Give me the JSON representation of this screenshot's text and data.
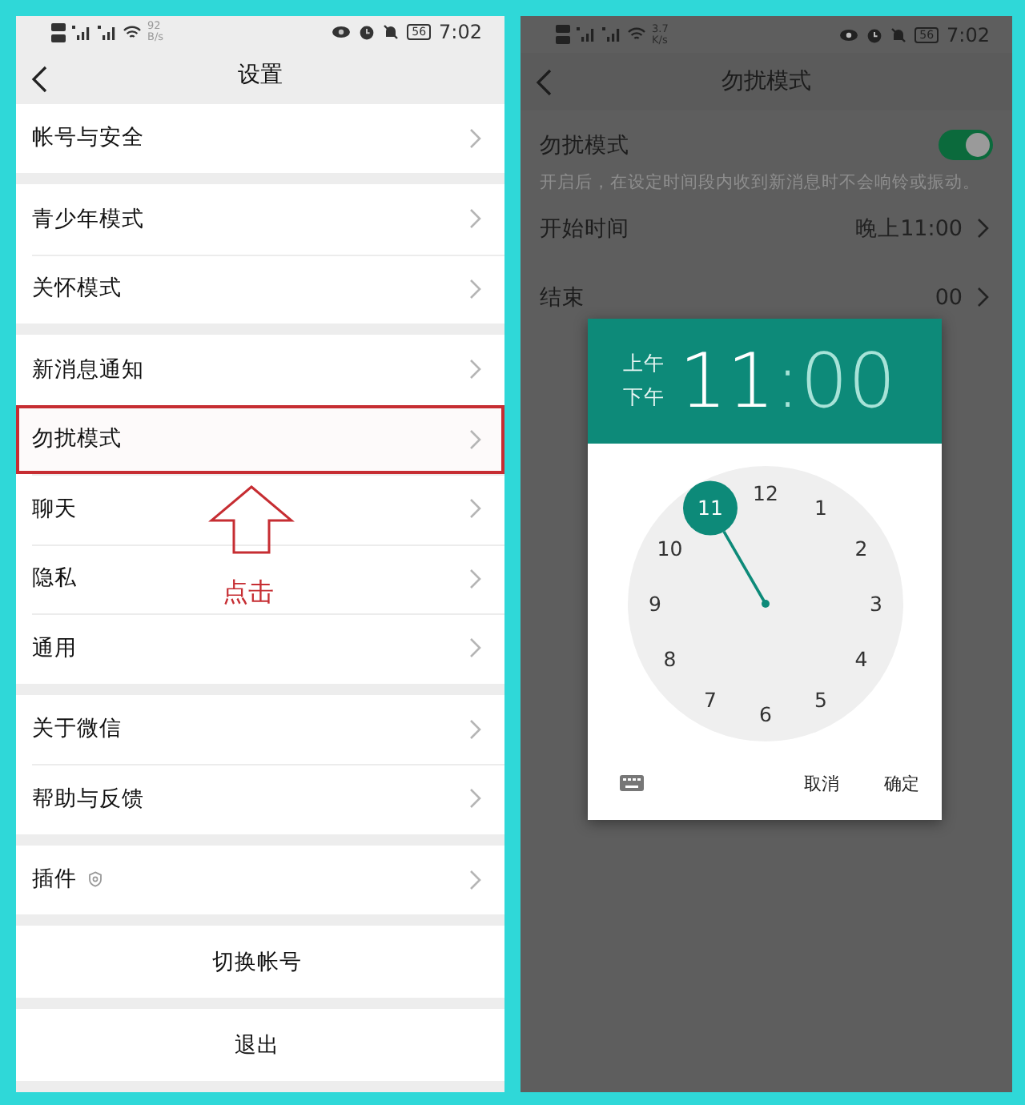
{
  "left_screen": {
    "status_bar": {
      "speed": "92",
      "speed_unit": "B/s",
      "battery": "56",
      "time": "7:02"
    },
    "title": "设置",
    "groups": [
      {
        "items": [
          {
            "label": "帐号与安全",
            "kind": "nav",
            "highlighted": false
          }
        ]
      },
      {
        "items": [
          {
            "label": "青少年模式",
            "kind": "nav",
            "highlighted": false
          },
          {
            "label": "关怀模式",
            "kind": "nav",
            "highlighted": false
          }
        ]
      },
      {
        "items": [
          {
            "label": "新消息通知",
            "kind": "nav",
            "highlighted": false
          },
          {
            "label": "勿扰模式",
            "kind": "nav",
            "highlighted": true
          },
          {
            "label": "聊天",
            "kind": "nav",
            "highlighted": false
          },
          {
            "label": "隐私",
            "kind": "nav",
            "highlighted": false
          },
          {
            "label": "通用",
            "kind": "nav",
            "highlighted": false
          }
        ]
      },
      {
        "items": [
          {
            "label": "关于微信",
            "kind": "nav",
            "highlighted": false
          },
          {
            "label": "帮助与反馈",
            "kind": "nav",
            "highlighted": false
          }
        ]
      },
      {
        "items": [
          {
            "label": "插件",
            "kind": "plugin",
            "highlighted": false
          }
        ]
      },
      {
        "items": [
          {
            "label": "切换帐号",
            "kind": "action",
            "highlighted": false
          }
        ]
      },
      {
        "items": [
          {
            "label": "退出",
            "kind": "action",
            "highlighted": false
          }
        ]
      }
    ],
    "annotation": {
      "label": "点击"
    }
  },
  "right_screen": {
    "status_bar": {
      "speed": "3.7",
      "speed_unit": "K/s",
      "battery": "56",
      "time": "7:02"
    },
    "title": "勿扰模式",
    "toggle_row": {
      "label": "勿扰模式",
      "on": true,
      "description": "开启后，在设定时间段内收到新消息时不会响铃或振动。"
    },
    "rows": [
      {
        "label": "开始时间",
        "value": "晚上11:00"
      },
      {
        "label": "结束",
        "value": "00"
      }
    ],
    "time_picker": {
      "am_pm": [
        {
          "label": "上午"
        },
        {
          "label": "下午"
        }
      ],
      "hour": {
        "text": "11",
        "selected": true
      },
      "separator": ":",
      "minute": {
        "text": "00",
        "selected": false
      },
      "dial": [
        {
          "label": "12",
          "selected": false
        },
        {
          "label": "1",
          "selected": false
        },
        {
          "label": "2",
          "selected": false
        },
        {
          "label": "3",
          "selected": false
        },
        {
          "label": "4",
          "selected": false
        },
        {
          "label": "5",
          "selected": false
        },
        {
          "label": "6",
          "selected": false
        },
        {
          "label": "7",
          "selected": false
        },
        {
          "label": "8",
          "selected": false
        },
        {
          "label": "9",
          "selected": false
        },
        {
          "label": "10",
          "selected": false
        },
        {
          "label": "11",
          "selected": true
        }
      ],
      "buttons": [
        "取消",
        "确定"
      ]
    }
  }
}
